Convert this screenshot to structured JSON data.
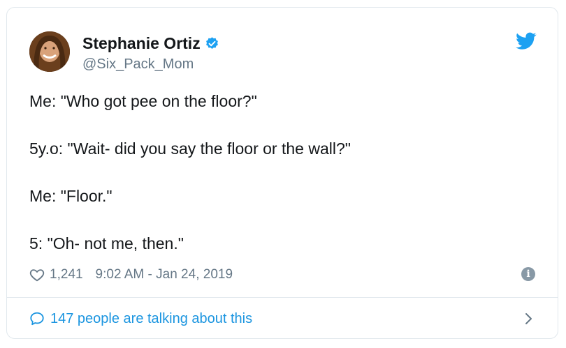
{
  "tweet": {
    "author": {
      "name": "Stephanie Ortiz",
      "handle": "@Six_Pack_Mom",
      "verified": true
    },
    "lines": [
      "Me: \"Who got pee on the floor?\"",
      "5y.o: \"Wait- did you say the floor or the wall?\"",
      "Me: \"Floor.\"",
      "5: \"Oh- not me, then.\""
    ],
    "likes": "1,241",
    "timestamp": "9:02 AM - Jan 24, 2019",
    "info_label": "i",
    "conversation": "147 people are talking about this"
  },
  "colors": {
    "brand_blue": "#1da1f2",
    "link_blue": "#1b95e0",
    "secondary_text": "#657786",
    "border": "#e1e8ed"
  },
  "icons": {
    "bird": "twitter-bird-icon",
    "verified": "verified-badge-icon",
    "heart": "heart-outline-icon",
    "info": "info-circle-icon",
    "bubble": "speech-bubble-icon",
    "chevron": "chevron-right-icon"
  }
}
